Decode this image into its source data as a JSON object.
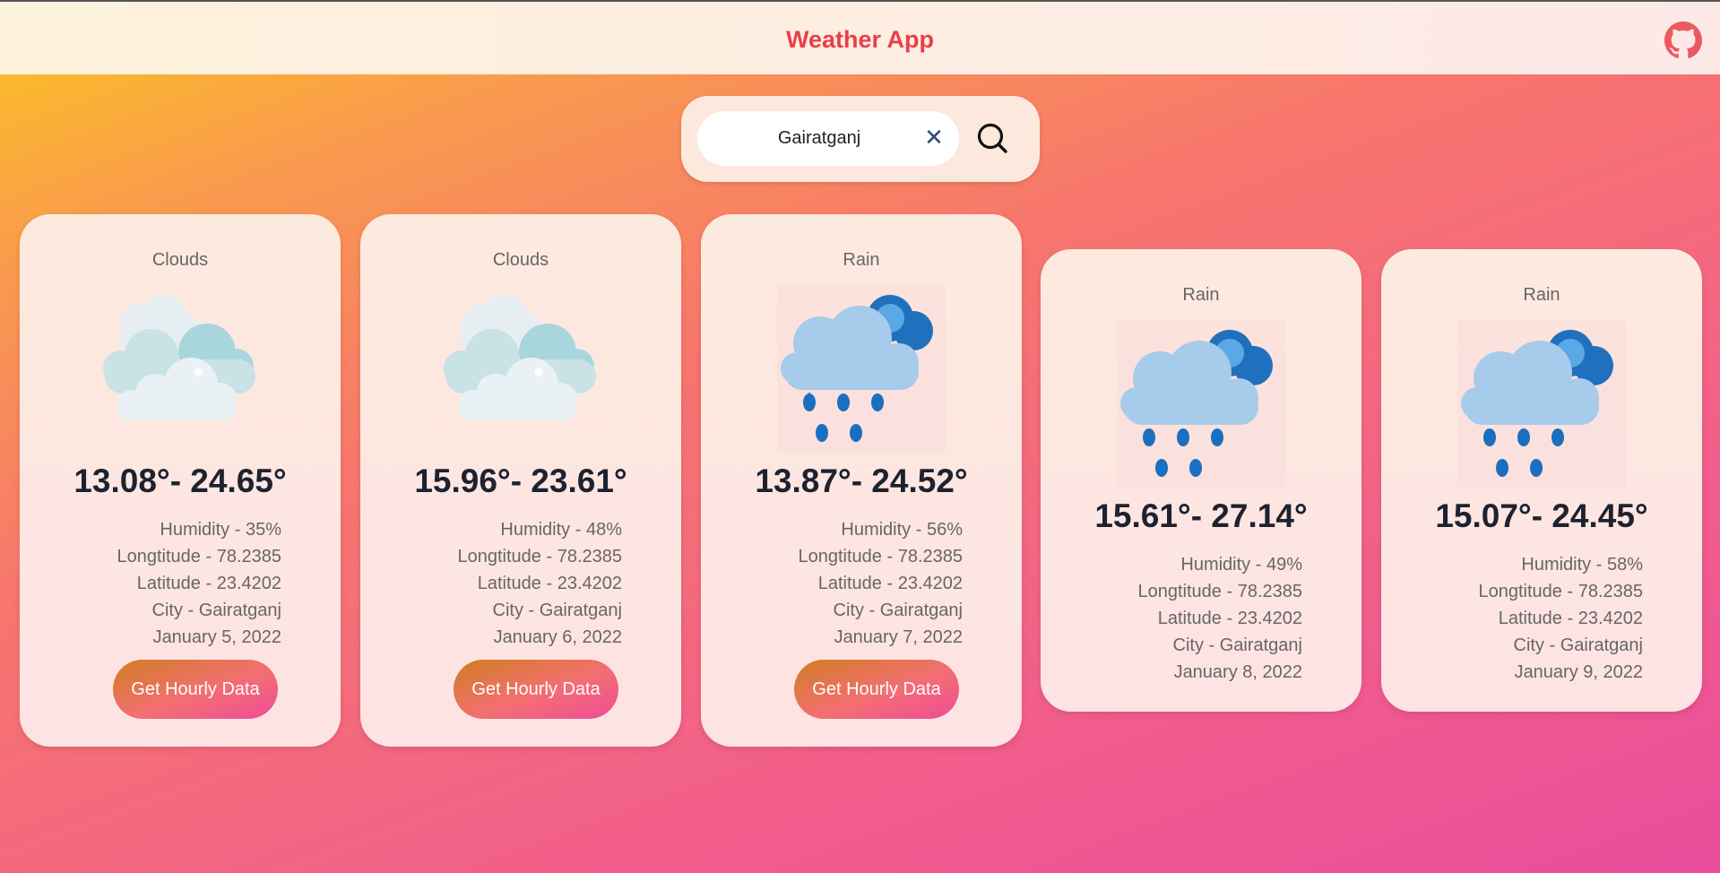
{
  "header": {
    "title": "Weather App"
  },
  "search": {
    "value": "Gairatganj",
    "placeholder": ""
  },
  "cards": [
    {
      "condition": "Clouds",
      "icon": "clouds-icon",
      "temp": "13.08°- 24.65°",
      "humidity": "Humidity - 35%",
      "longitude": "Longtitude - 78.2385",
      "latitude": "Latitude - 23.4202",
      "city": "City - Gairatganj",
      "date": "January 5, 2022",
      "button": "Get Hourly Data"
    },
    {
      "condition": "Clouds",
      "icon": "clouds-icon",
      "temp": "15.96°- 23.61°",
      "humidity": "Humidity - 48%",
      "longitude": "Longtitude - 78.2385",
      "latitude": "Latitude - 23.4202",
      "city": "City - Gairatganj",
      "date": "January 6, 2022",
      "button": "Get Hourly Data"
    },
    {
      "condition": "Rain",
      "icon": "rain-icon",
      "temp": "13.87°- 24.52°",
      "humidity": "Humidity - 56%",
      "longitude": "Longtitude - 78.2385",
      "latitude": "Latitude - 23.4202",
      "city": "City - Gairatganj",
      "date": "January 7, 2022",
      "button": "Get Hourly Data"
    },
    {
      "condition": "Rain",
      "icon": "rain-icon",
      "temp": "15.61°- 27.14°",
      "humidity": "Humidity - 49%",
      "longitude": "Longtitude - 78.2385",
      "latitude": "Latitude - 23.4202",
      "city": "City - Gairatganj",
      "date": "January 8, 2022"
    },
    {
      "condition": "Rain",
      "icon": "rain-icon",
      "temp": "15.07°- 24.45°",
      "humidity": "Humidity - 58%",
      "longitude": "Longtitude - 78.2385",
      "latitude": "Latitude - 23.4202",
      "city": "City - Gairatganj",
      "date": "January 9, 2022"
    }
  ],
  "colors": {
    "title": "#e8404a",
    "accent_start": "#d07d22",
    "accent_end": "#ee4c98"
  }
}
